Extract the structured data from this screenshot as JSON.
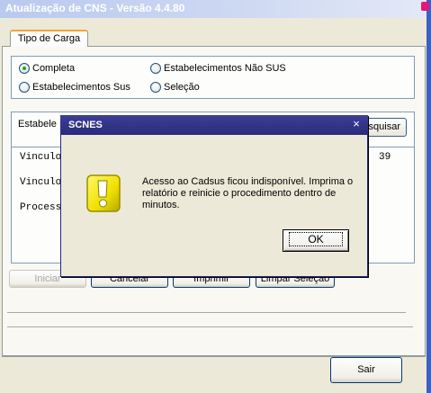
{
  "window": {
    "title": "Atualização de CNS - Versão 4.4.80"
  },
  "tabs": [
    {
      "label": "Tipo de Carga"
    }
  ],
  "carga_options": [
    {
      "label": "Completa",
      "checked": true
    },
    {
      "label": "Estabelecimentos Não SUS",
      "checked": false
    },
    {
      "label": "Estabelecimentos Sus",
      "checked": false
    },
    {
      "label": "Seleção",
      "checked": false
    }
  ],
  "estabelecimento": {
    "label": "Estabele",
    "search_button": "esquisar"
  },
  "results": {
    "lines": [
      "Vinculo",
      "Vinculo",
      "Process"
    ],
    "count": "39"
  },
  "actions": {
    "iniciar": "Iniciar",
    "cancelar": "Cancelar",
    "imprimir": "Imprimir",
    "limpar": "Limpar Seleção"
  },
  "footer": {
    "sair": "Sair"
  },
  "dialog": {
    "title": "SCNES",
    "close": "×",
    "icon": "warning-icon",
    "message": "Acesso ao Cadsus ficou indisponível. Imprima o relatório e reinicie o procedimento dentro de minutos.",
    "ok": "OK"
  },
  "colors": {
    "dialog_title_bg": "#2a2b7a",
    "warning_yellow": "#f0e000",
    "window_accent": "#3d5fc0"
  }
}
